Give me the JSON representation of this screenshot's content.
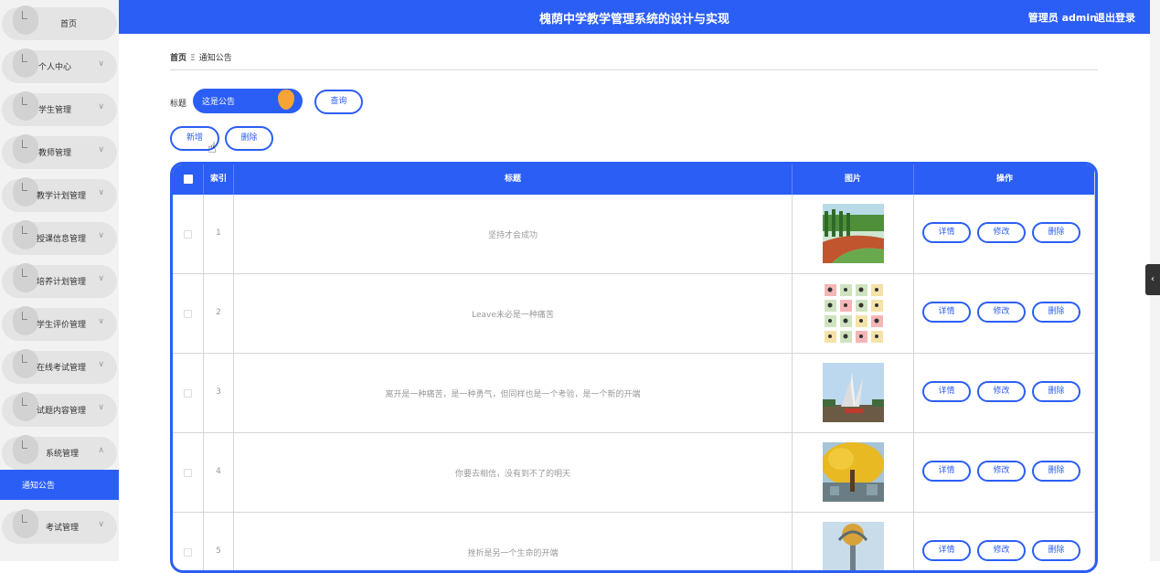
{
  "app": {
    "title": "槐荫中学教学管理系统的设计与实现",
    "user": "管理员 admin",
    "logout": "退出登录"
  },
  "sidebar": {
    "items": [
      {
        "label": "首页"
      },
      {
        "label": "个人中心"
      },
      {
        "label": "学生管理"
      },
      {
        "label": "教师管理"
      },
      {
        "label": "教学计划管理"
      },
      {
        "label": "授课信息管理"
      },
      {
        "label": "培养计划管理"
      },
      {
        "label": "学生评价管理"
      },
      {
        "label": "在线考试管理"
      },
      {
        "label": "试题内容管理"
      },
      {
        "label": "系统管理"
      },
      {
        "label": "考试管理"
      }
    ],
    "active_sub": "通知公告",
    "chevron_down": "∨",
    "chevron_up": "∧"
  },
  "breadcrumb": {
    "home": "首页",
    "sep": "Ξ",
    "current": "通知公告"
  },
  "search": {
    "label": "标题",
    "value": "这是公告",
    "query_button": "查询"
  },
  "actions": {
    "add": "新增",
    "delete": "删除"
  },
  "table": {
    "headers": {
      "index": "索引",
      "title": "标题",
      "image": "图片",
      "ops": "操作"
    },
    "ops": {
      "detail": "详情",
      "edit": "修改",
      "delete": "删除"
    },
    "rows": [
      {
        "index": "1",
        "title": "坚持才会成功",
        "image": "running-track-photo"
      },
      {
        "index": "2",
        "title": "Leave未必是一种痛苦",
        "image": "icon-grid-photo"
      },
      {
        "index": "3",
        "title": "离开是一种痛苦，是一种勇气，但同样也是一个考验，是一个新的开端",
        "image": "sculpture-photo"
      },
      {
        "index": "4",
        "title": "你要去相信，没有到不了的明天",
        "image": "ginkgo-tree-photo"
      },
      {
        "index": "5",
        "title": "挫折是另一个生命的开端",
        "image": "statue-photo"
      }
    ]
  },
  "colors": {
    "accent": "#2b5ef5"
  }
}
